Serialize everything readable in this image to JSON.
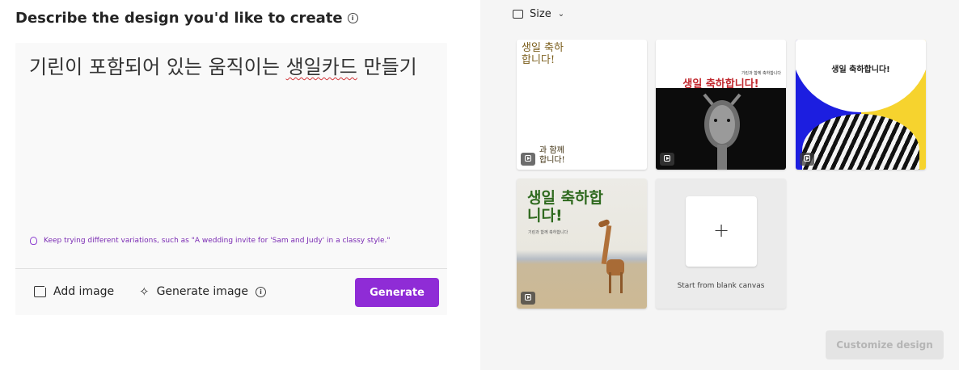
{
  "header": {
    "title": "Describe the design you'd like to create",
    "info_icon": "info-icon"
  },
  "editor": {
    "prompt_before": "기린이 포함되어 있는 움직이는 ",
    "prompt_misspelled": "생일카드",
    "prompt_after": " 만들기",
    "hint": "Keep trying different variations, such as \"A wedding invite for 'Sam and Judy' in a classy style.\"",
    "hint_icon": "lightbulb-icon"
  },
  "actions": {
    "add_image": "Add image",
    "generate_image": "Generate image",
    "generate": "Generate"
  },
  "colors": {
    "accent": "#8f2cd6",
    "hint": "#7a2bb3"
  },
  "sidebar": {
    "size_label": "Size",
    "templates": [
      {
        "id": "card-1",
        "heading": "생일 축하\n합니다!",
        "footer": "과 함께\n합니다!",
        "animated": true
      },
      {
        "id": "card-2",
        "heading": "생일 축하합니다!",
        "subtext": "기린과 함께 축하합니다",
        "animated": true
      },
      {
        "id": "card-3",
        "heading": "생일 축하합니다!",
        "animated": true
      },
      {
        "id": "card-4",
        "heading": "생일 축하합\n니다!",
        "subtext": "기린과 함께 축하합니다",
        "animated": true
      }
    ],
    "blank_label": "Start from blank canvas",
    "customize": "Customize design"
  }
}
